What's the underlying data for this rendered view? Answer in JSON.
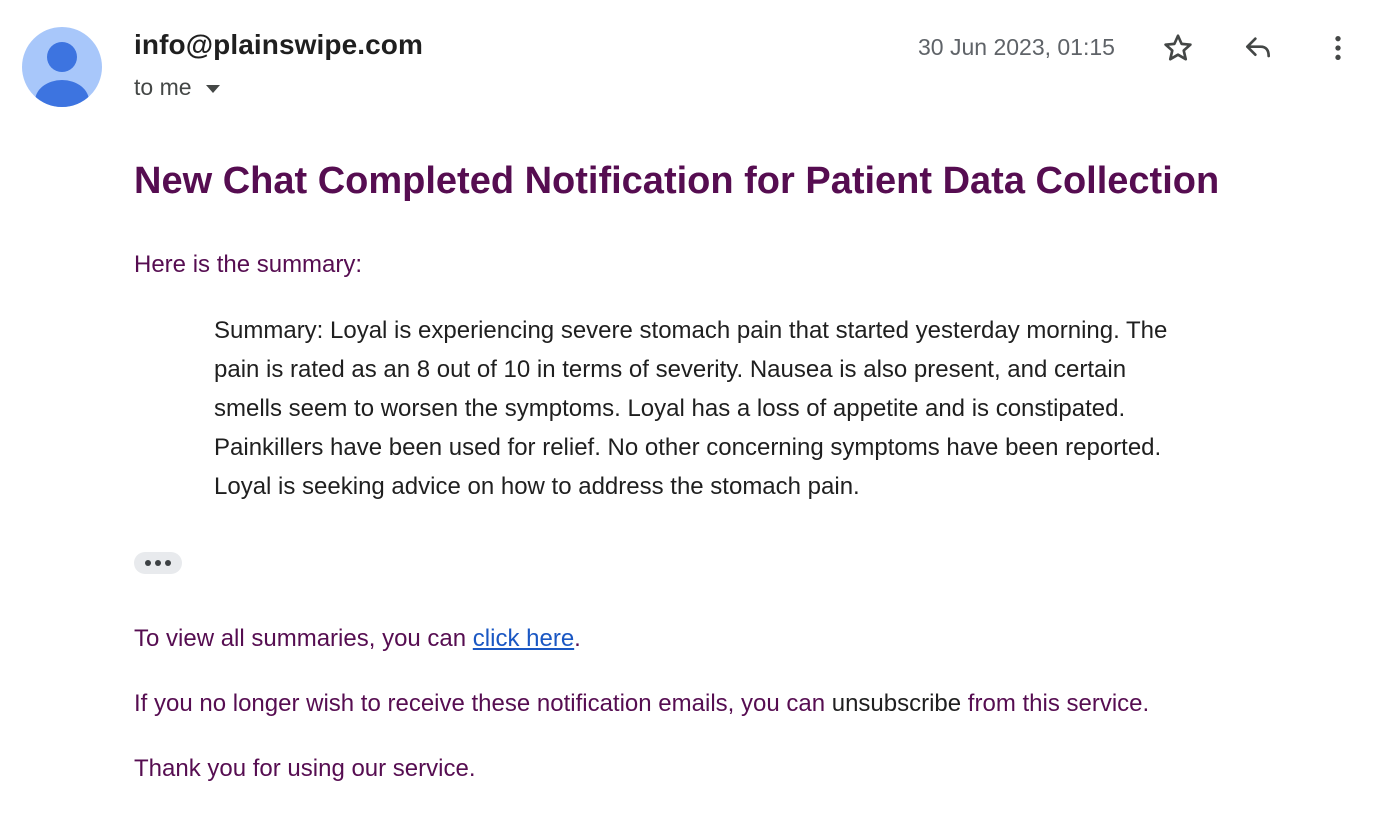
{
  "header": {
    "sender": "info@plainswipe.com",
    "recipient_label": "to me",
    "timestamp": "30 Jun 2023, 01:15"
  },
  "message": {
    "subject": "New Chat Completed Notification for Patient Data Collection",
    "intro": "Here is the summary:",
    "summary_lines": [
      "Summary: Loyal is experiencing severe stomach pain that started yesterday morning. The",
      "pain is rated as an 8 out of 10 in terms of severity. Nausea is also present, and certain",
      "smells seem to worsen the symptoms. Loyal has a loss of appetite and is constipated.",
      "Painkillers have been used for relief. No other concerning symptoms have been reported.",
      "Loyal is seeking advice on how to address the stomach pain."
    ],
    "view_prefix": "To view all summaries, you can ",
    "view_link": "click here",
    "view_suffix": ".",
    "unsub_prefix": "If you no longer wish to receive these notification emails, you can ",
    "unsub_word": "unsubscribe",
    "unsub_suffix": " from this service.",
    "thanks": "Thank you for using our service."
  },
  "icons": {
    "avatar": "person-icon",
    "star": "star-outline-icon",
    "reply": "reply-icon",
    "more": "more-vert-icon",
    "caret": "caret-down-icon",
    "trimmed": "ellipsis-icon"
  },
  "colors": {
    "subject_color": "#560d51",
    "link_color": "#1a57c3",
    "avatar_bg": "#a8c7fa",
    "avatar_fg": "#3d74e0"
  }
}
